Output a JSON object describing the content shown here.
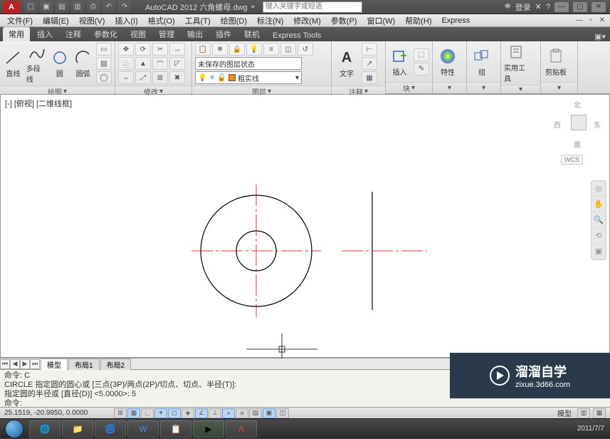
{
  "app": {
    "icon": "A",
    "title": "AutoCAD 2012   六角螺母.dwg"
  },
  "search": {
    "placeholder": "键入关键字或短语"
  },
  "titlebar_right": {
    "login": "登录"
  },
  "menubar": [
    "文件(F)",
    "编辑(E)",
    "视图(V)",
    "插入(I)",
    "格式(O)",
    "工具(T)",
    "绘图(D)",
    "标注(N)",
    "修改(M)",
    "参数(P)",
    "窗口(W)",
    "帮助(H)",
    "Express"
  ],
  "ribbon_tabs": [
    "常用",
    "插入",
    "注释",
    "参数化",
    "视图",
    "管理",
    "输出",
    "插件",
    "联机",
    "Express Tools"
  ],
  "panels": {
    "draw": {
      "title": "绘图",
      "btns": {
        "line": "直线",
        "polyline": "多段线",
        "circle": "圆",
        "arc": "圆弧"
      }
    },
    "modify": {
      "title": "修改"
    },
    "layer": {
      "title": "图层",
      "combo1": "未保存的图层状态",
      "combo2": "粗实线"
    },
    "annotate": {
      "title": "注释",
      "text": "文字"
    },
    "block": {
      "title": "块",
      "insert": "插入"
    },
    "props": {
      "title": "特性"
    },
    "group": {
      "title": "组"
    },
    "util": {
      "title": "实用工具"
    },
    "clip": {
      "title": "剪贴板"
    }
  },
  "viewport": {
    "label": "[-] [俯视] [二维线框]",
    "wcs": "WCS",
    "compass": {
      "n": "北",
      "s": "南",
      "e": "东",
      "w": "西"
    }
  },
  "model_tabs": {
    "model": "模型",
    "layout1": "布局1",
    "layout2": "布局2"
  },
  "command": {
    "l1": "命令: C",
    "l2": "CIRCLE 指定圆的圆心或 [三点(3P)/两点(2P)/切点、切点、半径(T)]:",
    "l3": "指定圆的半径或 [直径(D)] <5.0000>: 5",
    "prompt": "命令:"
  },
  "status": {
    "coords": "25.1519, -20.9850, 0.0000",
    "model": "模型"
  },
  "watermark": {
    "brand": "溜溜自学",
    "url": "zixue.3d66.com"
  },
  "taskbar": {
    "date": "2011/7/7"
  }
}
